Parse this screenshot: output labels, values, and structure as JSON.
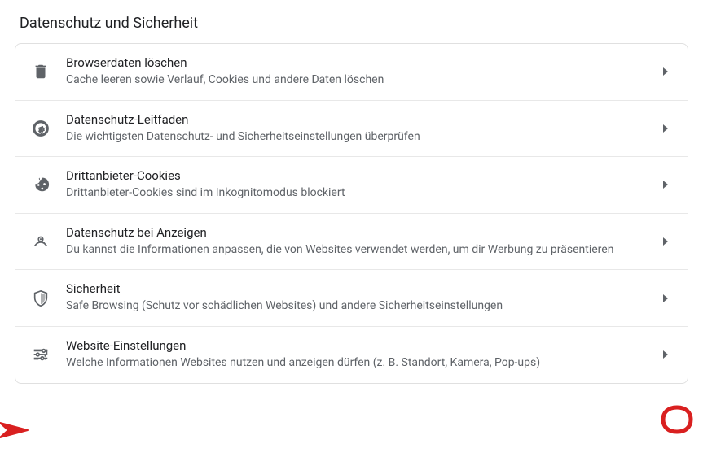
{
  "header": {
    "title": "Datenschutz und Sicherheit"
  },
  "settings": {
    "rows": [
      {
        "id": "clear-data",
        "title": "Browserdaten löschen",
        "subtitle": "Cache leeren sowie Verlauf, Cookies und andere Daten löschen",
        "icon": "trash-icon"
      },
      {
        "id": "privacy-guide",
        "title": "Datenschutz-Leitfaden",
        "subtitle": "Die wichtigsten Datenschutz- und Sicherheitseinstellungen überprüfen",
        "icon": "compass-icon"
      },
      {
        "id": "third-party-cookies",
        "title": "Drittanbieter-Cookies",
        "subtitle": "Drittanbieter-Cookies sind im Inkognitomodus blockiert",
        "icon": "cookie-icon"
      },
      {
        "id": "ad-privacy",
        "title": "Datenschutz bei Anzeigen",
        "subtitle": "Du kannst die Informationen anpassen, die von Websites verwendet werden, um dir Werbung zu präsentieren",
        "icon": "eye-radar-icon"
      },
      {
        "id": "security",
        "title": "Sicherheit",
        "subtitle": "Safe Browsing (Schutz vor schädlichen Websites) und andere Sicherheitseinstellungen",
        "icon": "shield-icon"
      },
      {
        "id": "site-settings",
        "title": "Website-Einstellungen",
        "subtitle": "Welche Informationen Websites nutzen und anzeigen dürfen (z. B. Standort, Kamera, Pop-ups)",
        "icon": "sliders-icon"
      }
    ]
  }
}
